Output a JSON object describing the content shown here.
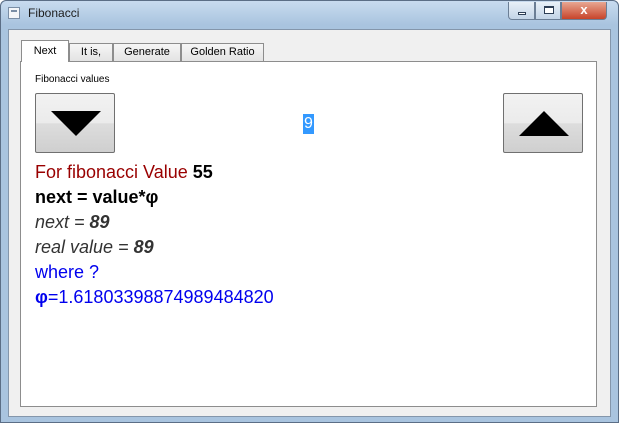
{
  "window": {
    "title": "Fibonacci",
    "minimize_label": "",
    "maximize_label": "",
    "close_label": "x"
  },
  "tabs": [
    {
      "label": "Next",
      "active": true
    },
    {
      "label": "It is,",
      "active": false
    },
    {
      "label": "Generate",
      "active": false
    },
    {
      "label": "Golden Ratio",
      "active": false
    }
  ],
  "panel": {
    "group_label": "Fibonacci values",
    "index_value": "9",
    "down_icon": "triangle-down-icon",
    "up_icon": "triangle-up-icon"
  },
  "text": {
    "line1_prefix": "For fibonacci Value ",
    "line1_value": "55",
    "line2": "next = value*φ",
    "line3_prefix": "next = ",
    "line3_value": "89",
    "line4_prefix": "real value = ",
    "line4_value": "89",
    "line5": "where ?",
    "line6_symbol": "φ",
    "line6_value": "=1.61803398874989484820"
  },
  "colors": {
    "highlight": "#3399ff",
    "dark_red": "#990000",
    "blue": "#0000ee"
  }
}
